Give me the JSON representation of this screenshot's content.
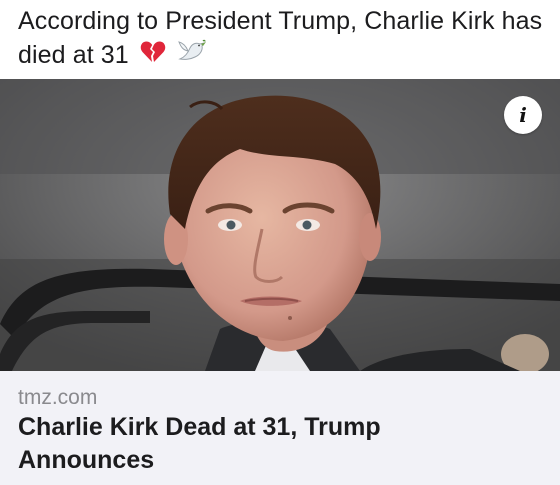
{
  "post": {
    "text": "According to President Trump, Charlie Kirk has died at 31",
    "emoji_icons": [
      "broken-heart-icon",
      "dove-icon"
    ]
  },
  "link_preview": {
    "image_alt": "Photo of Charlie Kirk",
    "info_icon": "info-icon",
    "info_glyph": "i",
    "source": "tmz.com",
    "headline": "Charlie Kirk Dead at 31, Trump Announces"
  },
  "colors": {
    "text": "#1c1c1e",
    "source_gray": "#8a8a8e",
    "card_background": "#f2f2f7",
    "broken_heart": "#e0263a"
  }
}
